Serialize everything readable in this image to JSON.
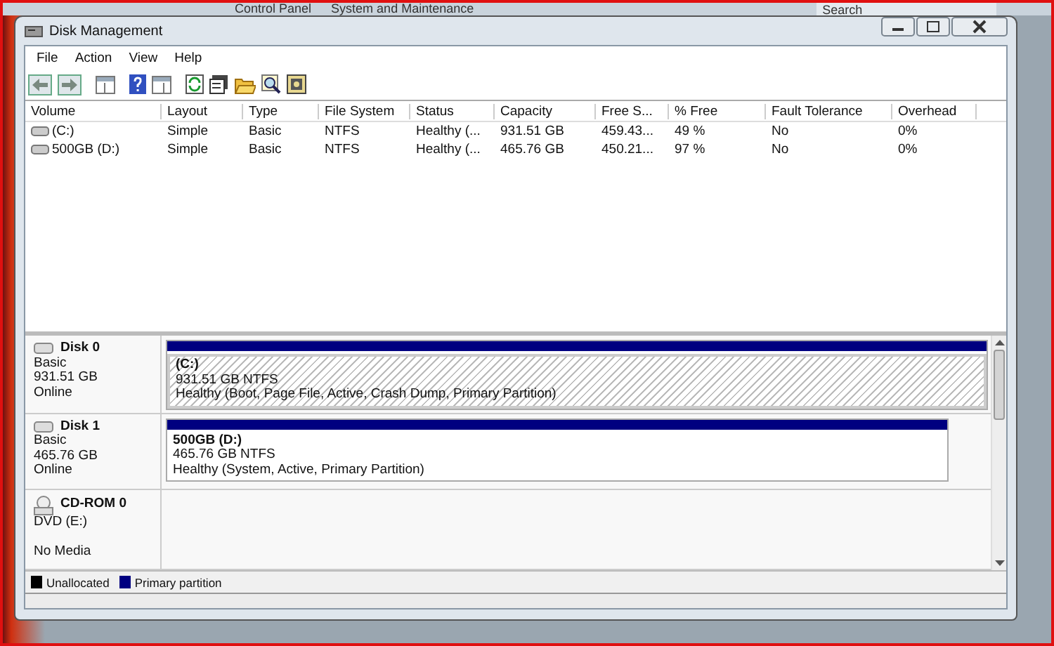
{
  "background_window": {
    "breadcrumb": [
      "Control Panel",
      "System and Maintenance"
    ],
    "search": {
      "placeholder": "Search"
    }
  },
  "window": {
    "title": "Disk Management"
  },
  "menu": [
    "File",
    "Action",
    "View",
    "Help"
  ],
  "table": {
    "columns": [
      "Volume",
      "Layout",
      "Type",
      "File System",
      "Status",
      "Capacity",
      "Free S...",
      "% Free",
      "Fault Tolerance",
      "Overhead"
    ],
    "rows": [
      [
        "(C:)",
        "Simple",
        "Basic",
        "NTFS",
        "Healthy (...",
        "931.51 GB",
        "459.43...",
        "49 %",
        "No",
        "0%"
      ],
      [
        "500GB (D:)",
        "Simple",
        "Basic",
        "NTFS",
        "Healthy (...",
        "465.76 GB",
        "450.21...",
        "97 %",
        "No",
        "0%"
      ]
    ]
  },
  "disks": [
    {
      "kind": "disk",
      "name": "Disk 0",
      "type": "Basic",
      "size": "931.51 GB",
      "state": "Online",
      "partitions": [
        {
          "name": "(C:)",
          "size": "931.51 GB NTFS",
          "status": "Healthy (Boot, Page File, Active, Crash Dump, Primary Partition)",
          "selected": true
        }
      ]
    },
    {
      "kind": "disk",
      "name": "Disk 1",
      "type": "Basic",
      "size": "465.76 GB",
      "state": "Online",
      "partitions": [
        {
          "name": "500GB  (D:)",
          "size": "465.76 GB NTFS",
          "status": "Healthy (System, Active, Primary Partition)",
          "selected": false
        }
      ]
    },
    {
      "kind": "cdrom",
      "name": "CD-ROM 0",
      "type": "DVD (E:)",
      "state": "No Media"
    }
  ],
  "legend": [
    {
      "label": "Unallocated",
      "color": "#000000"
    },
    {
      "label": "Primary partition",
      "color": "#000080"
    }
  ]
}
